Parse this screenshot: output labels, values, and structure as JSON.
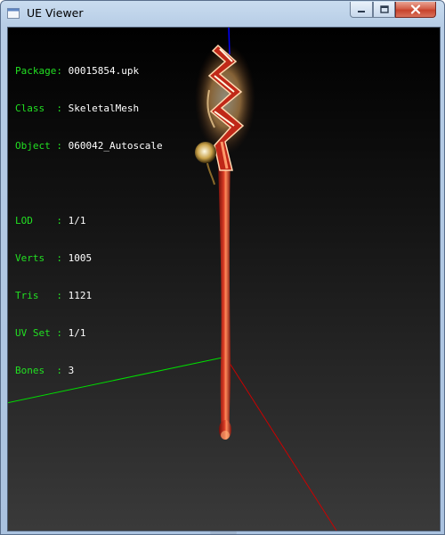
{
  "window": {
    "title": "UE Viewer",
    "controls": {
      "minimize_icon": "minimize-icon",
      "maximize_icon": "maximize-icon",
      "close_icon": "close-icon"
    }
  },
  "info": [
    {
      "label": "Package",
      "sep": ": ",
      "value": "00015854.upk"
    },
    {
      "label": "Class  ",
      "sep": ": ",
      "value": "SkeletalMesh"
    },
    {
      "label": "Object ",
      "sep": ": ",
      "value": "060042_Autoscale"
    },
    {
      "label": "LOD    ",
      "sep": ": ",
      "value": "1/1"
    },
    {
      "label": "Verts  ",
      "sep": ": ",
      "value": "1005"
    },
    {
      "label": "Tris   ",
      "sep": ": ",
      "value": "1121"
    },
    {
      "label": "UV Set ",
      "sep": ": ",
      "value": "1/1"
    },
    {
      "label": "Bones  ",
      "sep": ": ",
      "value": "3"
    }
  ],
  "colors": {
    "label": "#22e022",
    "value": "#ffffff",
    "axis_x": "#cc0000",
    "axis_y": "#00dd00",
    "axis_z": "#0000ff",
    "staff": "#b8201a",
    "staff_highlight": "#ff8a5a",
    "glow": "#ffe2a8"
  }
}
